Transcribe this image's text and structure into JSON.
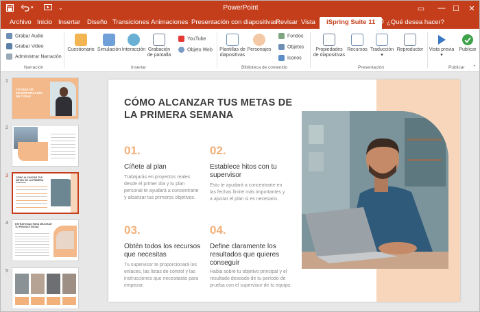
{
  "app": {
    "title": "PowerPoint"
  },
  "window": {
    "minimize": "—",
    "maximize": "☐",
    "close": "✕",
    "ribbon_toggle": "▭"
  },
  "tabs": [
    "Archivo",
    "Inicio",
    "Insertar",
    "Diseño",
    "Transiciones",
    "Animaciones",
    "Presentación con diapositivas",
    "Revisar",
    "Vista",
    "iSpring Suite 11"
  ],
  "search": {
    "label": "¿Qué desea hacer?"
  },
  "ribbon": {
    "narracion": {
      "grabar_audio": "Grabar Audio",
      "grabar_video": "Grabar Video",
      "administrar": "Administrar Narración",
      "label": "Narración"
    },
    "insertar": {
      "cuestionario": "Cuestionario",
      "simulacion": "Simulación",
      "interaccion": "Interacción",
      "grabacion1": "Grabación",
      "grabacion2": "de pantalla",
      "youtube": "YouTube",
      "objeto_web": "Objeto Web",
      "label": "Insertar"
    },
    "biblioteca": {
      "plantillas1": "Plantillas de",
      "plantillas2": "diapositivas",
      "personajes": "Personajes",
      "fondos": "Fondos",
      "objetos": "Objetos",
      "iconos": "Iconos",
      "label": "Biblioteca de contenido"
    },
    "presentacion": {
      "propiedades1": "Propiedades",
      "propiedades2": "de diapositivas",
      "recursos": "Recursos",
      "traduccion": "Traducción",
      "reproductor": "Reproductor",
      "label": "Presentación"
    },
    "publicar": {
      "vista_previa": "Vista previa",
      "publicar": "Publicar",
      "label": "Publicar"
    }
  },
  "thumbnails": {
    "numbers": [
      "1",
      "2",
      "3",
      "4",
      "5"
    ],
    "t1_title": "TU GUÍA DE INCORPORACIÓN EN 7 DÍAS",
    "t3_title": "CÓMO ALCANZAR TUS METAS DE LA PRIMERA SEMANA",
    "t4_title": "ESTRATEGIAS PARA MEJORAR TU PRODUCTIVIDAD"
  },
  "slide": {
    "title": "CÓMO ALCANZAR TUS METAS DE LA PRIMERA SEMANA",
    "items": [
      {
        "num": "01.",
        "title": "Cíñete al plan",
        "body": "Trabajarás en proyectos reales desde el primer día y tu plan personal te ayudará a concentrarte y alcanzar tus primeros objetivos."
      },
      {
        "num": "02.",
        "title": "Establece hitos con tu supervisor",
        "body": "Esto te ayudará a concentrarte en las fechas límite más importantes y a ajustar el plan si es necesario."
      },
      {
        "num": "03.",
        "title": "Obtén todos los recursos que necesitas",
        "body": "Tu supervisor te proporcionará los enlaces, las listas de control y las instrucciones que necesitarás para empezar."
      },
      {
        "num": "04.",
        "title": "Define claramente los resultados que quieres conseguir",
        "body": "Habla sobre tu objetivo principal y el resultado deseado de tu período de prueba con el supervisor de tu equipo."
      }
    ]
  },
  "colors": {
    "brand": "#c43e1c",
    "accent": "#f2b07a",
    "peach": "#f8d6bb"
  }
}
